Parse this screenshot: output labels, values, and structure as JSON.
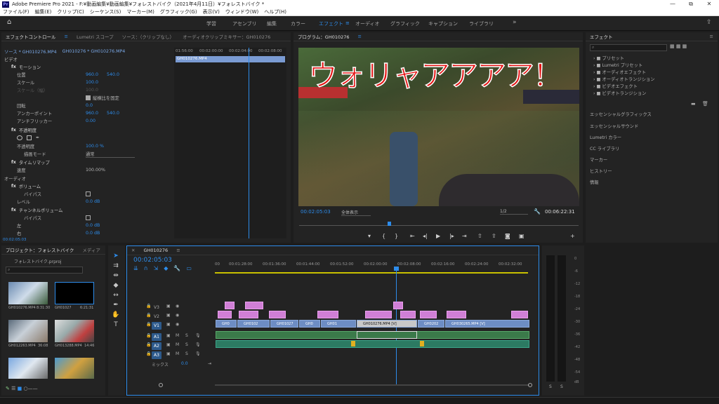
{
  "title_bar": {
    "logo": "Pr",
    "title": "Adobe Premiere Pro 2021 - F:¥動画編集¥動画編集¥フォレストバイク（2021年4月11日）¥フォレストバイク *",
    "min": "—",
    "restore": "⧉",
    "close": "✕"
  },
  "menu": [
    "ファイル(F)",
    "編集(E)",
    "クリップ(C)",
    "シーケンス(S)",
    "マーカー(M)",
    "グラフィック(G)",
    "表示(V)",
    "ウィンドウ(W)",
    "ヘルプ(H)"
  ],
  "workspaces": {
    "home": "⌂",
    "items": [
      "学習",
      "アセンブリ",
      "編集",
      "カラー",
      "エフェクト",
      "オーディオ",
      "グラフィック",
      "キャプション",
      "ライブラリ"
    ],
    "active": "エフェクト",
    "more": "»"
  },
  "effect_controls": {
    "tabs": [
      "エフェクトコントロール",
      "Lumetri スコープ",
      "ソース：（クリップなし）",
      "オーディオクリップミキサー：GH010276"
    ],
    "source_label": "ソース * GH010276.MP4",
    "clip_label": "GH010276 * GH010276.MP4",
    "tl_times": [
      "01:56:00",
      "00:02:00:00",
      "00:02:04:00",
      "00:02:08:00"
    ],
    "tl_clip": "GH010276.MP4",
    "video_label": "ビデオ",
    "motion": "モーション",
    "position": {
      "label": "位置",
      "x": "960.0",
      "y": "540.0"
    },
    "scale": {
      "label": "スケール",
      "value": "100.0"
    },
    "scale_w": {
      "label": "スケール（幅）",
      "value": "100.0"
    },
    "uniform": "縦横比を固定",
    "rotation": {
      "label": "回転",
      "value": "0.0"
    },
    "anchor": {
      "label": "アンカーポイント",
      "x": "960.0",
      "y": "540.0"
    },
    "antiflicker": {
      "label": "アンチフリッカー",
      "value": "0.00"
    },
    "opacity": "不透明度",
    "opacity_val": {
      "label": "不透明度",
      "value": "100.0 %"
    },
    "blend": {
      "label": "描画モード",
      "value": "通常"
    },
    "timeremap": "タイムリマップ",
    "speed": {
      "label": "速度",
      "value": "100.00%"
    },
    "audio_label": "オーディオ",
    "volume": "ボリューム",
    "bypass": "バイパス",
    "level": {
      "label": "レベル",
      "value": "0.0 dB"
    },
    "channel_volume": "チャンネルボリューム",
    "bypass2": "バイパス",
    "left": {
      "label": "左",
      "value": "0.0 dB"
    },
    "right": {
      "label": "右",
      "value": "0.0 dB"
    },
    "bottom_time": "00:02:05:03"
  },
  "program": {
    "title": "プログラム：GH010276",
    "overlay": "ウォリャアアアア！",
    "timecode": "00:02:05:03",
    "fit": "全体表示",
    "quality": "1/2",
    "duration": "00:06:22:31"
  },
  "effects_panel": {
    "title": "エフェクト",
    "tree": [
      "プリセット",
      "Lumetri プリセット",
      "オーディオエフェクト",
      "オーディオトランジション",
      "ビデオエフェクト",
      "ビデオトランジション"
    ],
    "sections": [
      "エッセンシャルグラフィックス",
      "エッセンシャルサウンド",
      "Lumetri カラー",
      "CC ライブラリ",
      "マーカー",
      "ヒストリー",
      "情報"
    ]
  },
  "project": {
    "tabs": [
      "プロジェクト：フォレストバイク",
      "メディア"
    ],
    "path": "フォレストバイク.prproj",
    "thumbs": [
      {
        "name": "GH010276.MP4",
        "dur": "8:31:30"
      },
      {
        "name": "GH01027",
        "dur": "6:21:31"
      },
      {
        "name": "GH012263.MP4",
        "dur": "36:08"
      },
      {
        "name": "GH013288.MP4",
        "dur": "14:46"
      }
    ]
  },
  "timeline": {
    "tab": "GH010276",
    "timecode": "00:02:05:03",
    "ticks": [
      "00",
      "00:01:28:00",
      "00:01:36:00",
      "00:01:44:00",
      "00:01:52:00",
      "00:02:00:00",
      "00:02:08:00",
      "00:02:16:00",
      "00:02:24:00",
      "00:02:32:00"
    ],
    "tracks": [
      "V3",
      "V2",
      "V1",
      "A1",
      "A2",
      "A3"
    ],
    "mix_label": "ミックス",
    "mix_value": "0.0",
    "v1_clips": [
      "GH0",
      "GH0102",
      "GH01027",
      "GH0",
      "GH01",
      "GH010276.MP4 [V]",
      "GH0202",
      "GH030265.MP4 [V]"
    ],
    "fx_label": "fx"
  },
  "meter": {
    "scale": [
      "0",
      "-6",
      "-12",
      "-18",
      "-24",
      "-30",
      "-36",
      "-42",
      "-48",
      "-54",
      "dB"
    ],
    "s1": "S",
    "s2": "S"
  }
}
